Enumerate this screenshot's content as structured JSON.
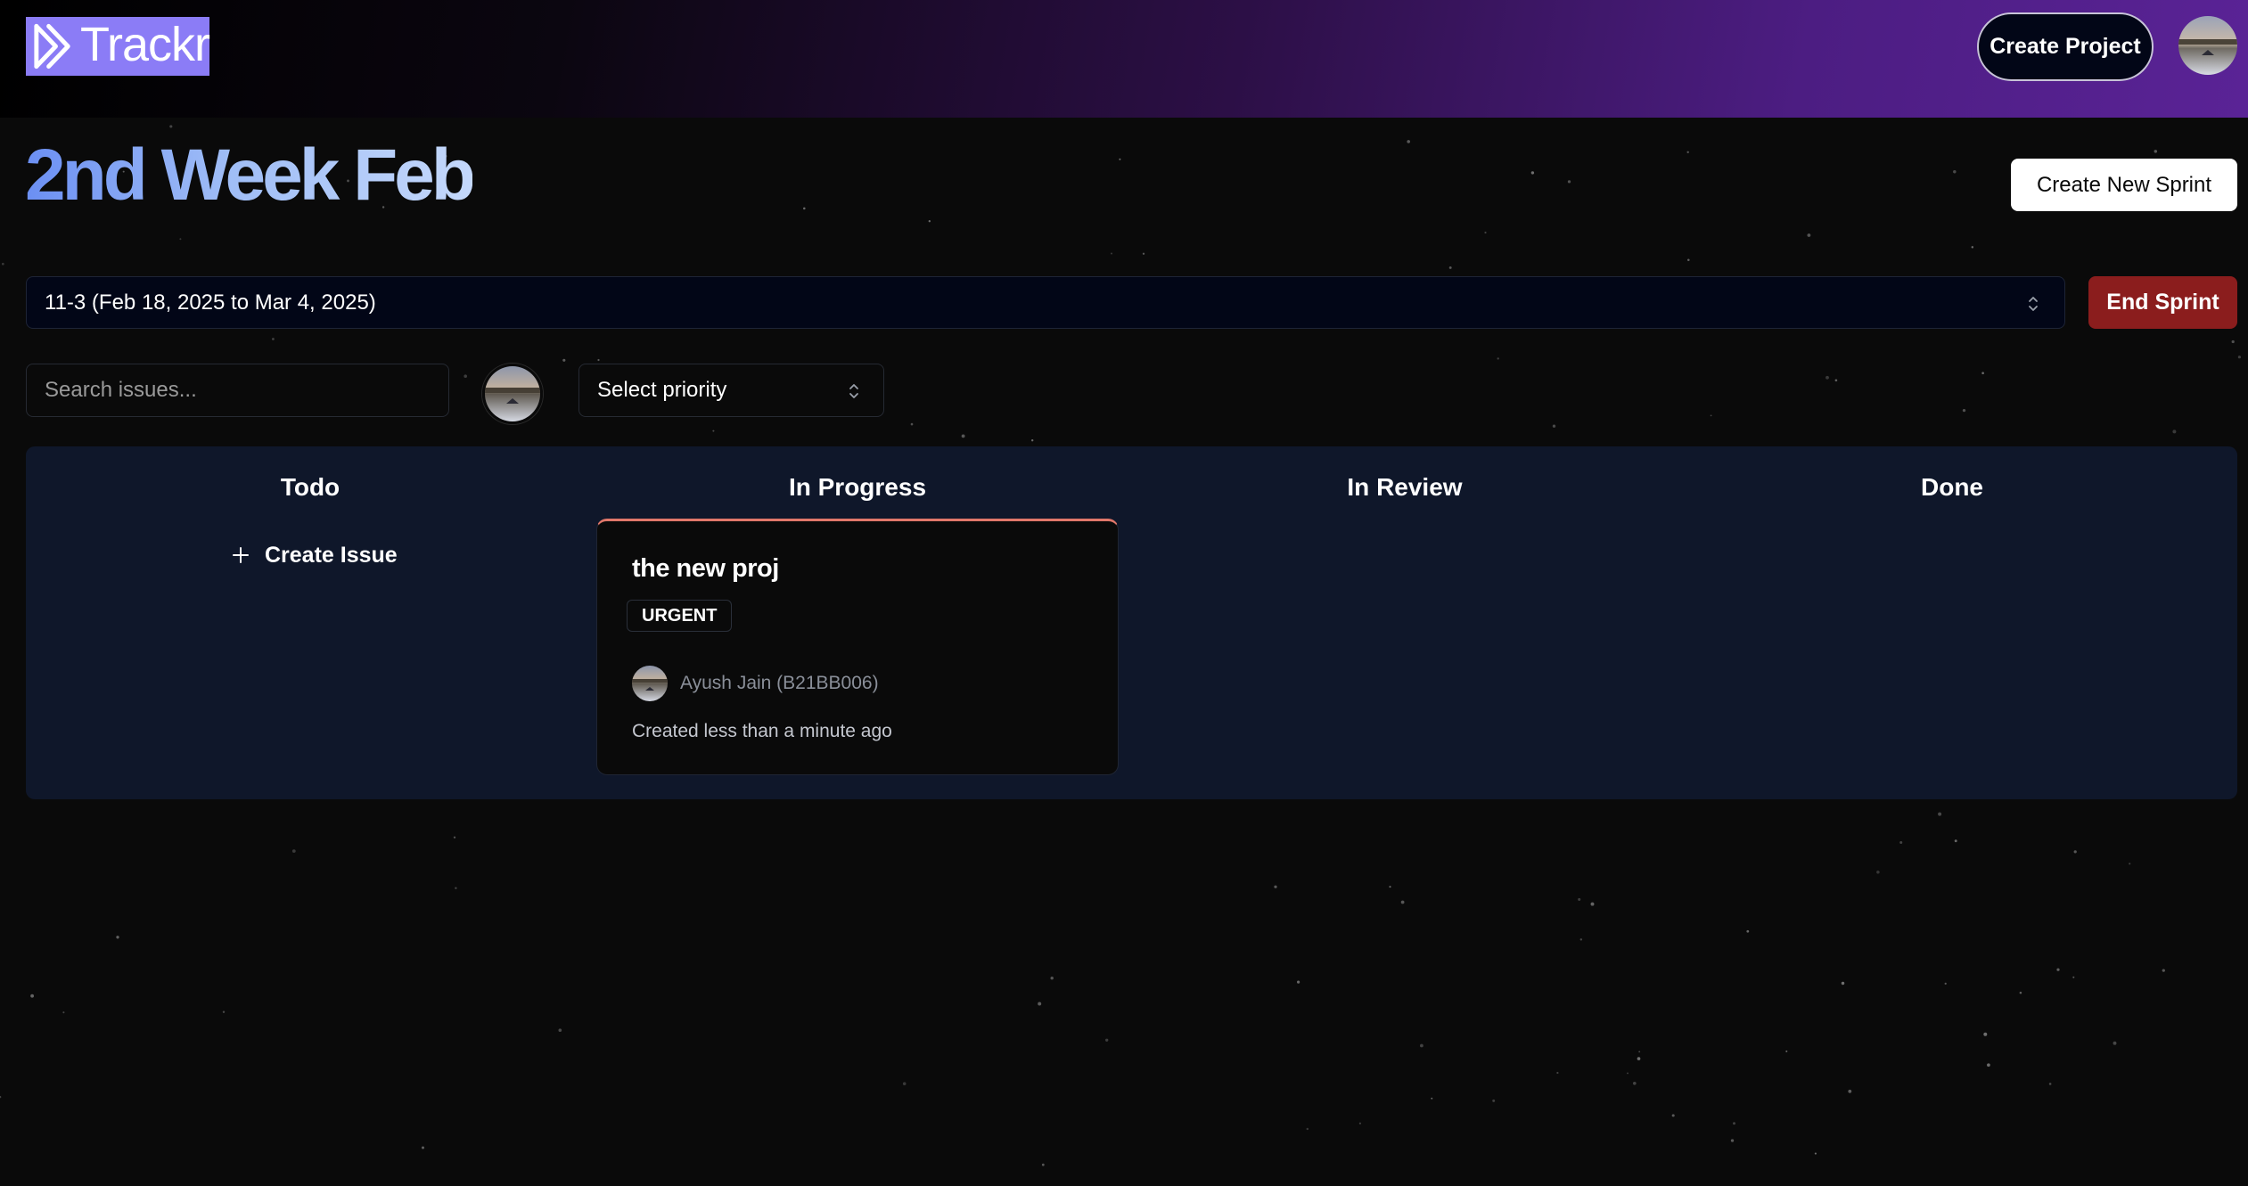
{
  "app": {
    "name": "Trackr",
    "brand_color": "#8b7cf6"
  },
  "header": {
    "create_project_label": "Create Project",
    "avatar_icon": "user-avatar-icon"
  },
  "sprint": {
    "title": "2nd Week Feb",
    "create_new_sprint_label": "Create New Sprint",
    "selected": "11-3 (Feb 18, 2025 to Mar 4, 2025)",
    "end_sprint_label": "End Sprint",
    "end_sprint_color": "#8b1d1d"
  },
  "filters": {
    "search_placeholder": "Search issues...",
    "priority_placeholder": "Select priority"
  },
  "board": {
    "columns": [
      {
        "title": "Todo"
      },
      {
        "title": "In Progress"
      },
      {
        "title": "In Review"
      },
      {
        "title": "Done"
      }
    ],
    "create_issue_label": "Create Issue",
    "issues": [
      {
        "title": "the new proj",
        "priority": "URGENT",
        "priority_color": "#e0776a",
        "assignee": "Ayush Jain (B21BB006)",
        "created": "Created less than a minute ago"
      }
    ]
  }
}
